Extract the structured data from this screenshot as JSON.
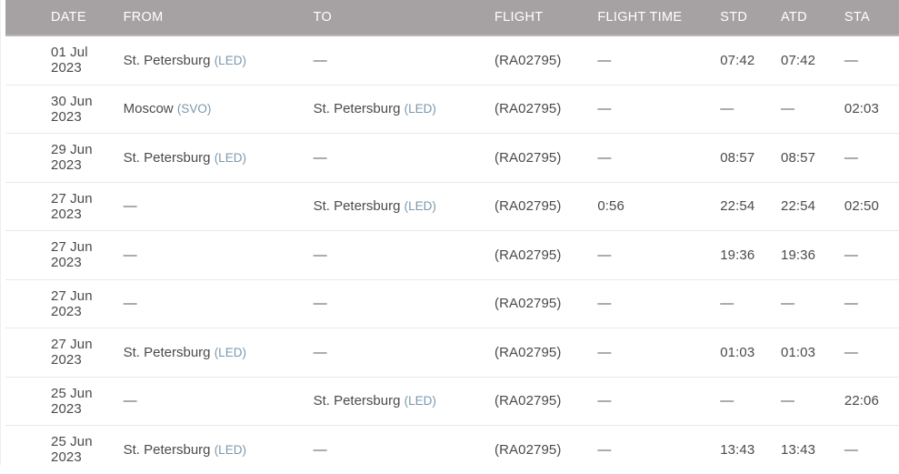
{
  "table": {
    "columns": [
      {
        "key": "date",
        "label": "DATE"
      },
      {
        "key": "from",
        "label": "FROM"
      },
      {
        "key": "to",
        "label": "TO"
      },
      {
        "key": "flight",
        "label": "FLIGHT"
      },
      {
        "key": "ftime",
        "label": "FLIGHT TIME"
      },
      {
        "key": "std",
        "label": "STD"
      },
      {
        "key": "atd",
        "label": "ATD"
      },
      {
        "key": "sta",
        "label": "STA"
      }
    ],
    "empty_value": "—",
    "rows": [
      {
        "date": "01 Jul 2023",
        "from_city": "St. Petersburg",
        "from_code": "(LED)",
        "to_city": "",
        "to_code": "",
        "to_empty": "—",
        "flight": "(RA02795)",
        "ftime": "—",
        "std": "07:42",
        "atd": "07:42",
        "sta": "—"
      },
      {
        "date": "30 Jun 2023",
        "from_city": "Moscow",
        "from_code": "(SVO)",
        "to_city": "St. Petersburg",
        "to_code": "(LED)",
        "to_empty": "",
        "flight": "(RA02795)",
        "ftime": "—",
        "std": "—",
        "atd": "—",
        "sta": "02:03"
      },
      {
        "date": "29 Jun 2023",
        "from_city": "St. Petersburg",
        "from_code": "(LED)",
        "to_city": "",
        "to_code": "",
        "to_empty": "—",
        "flight": "(RA02795)",
        "ftime": "—",
        "std": "08:57",
        "atd": "08:57",
        "sta": "—"
      },
      {
        "date": "27 Jun 2023",
        "from_city": "",
        "from_code": "",
        "from_empty": "—",
        "to_city": "St. Petersburg",
        "to_code": "(LED)",
        "to_empty": "",
        "flight": "(RA02795)",
        "ftime": "0:56",
        "std": "22:54",
        "atd": "22:54",
        "sta": "02:50"
      },
      {
        "date": "27 Jun 2023",
        "from_city": "",
        "from_code": "",
        "from_empty": "—",
        "to_city": "",
        "to_code": "",
        "to_empty": "—",
        "flight": "(RA02795)",
        "ftime": "—",
        "std": "19:36",
        "atd": "19:36",
        "sta": "—"
      },
      {
        "date": "27 Jun 2023",
        "from_city": "",
        "from_code": "",
        "from_empty": "—",
        "to_city": "",
        "to_code": "",
        "to_empty": "—",
        "flight": "(RA02795)",
        "ftime": "—",
        "std": "—",
        "atd": "—",
        "sta": "—"
      },
      {
        "date": "27 Jun 2023",
        "from_city": "St. Petersburg",
        "from_code": "(LED)",
        "to_city": "",
        "to_code": "",
        "to_empty": "—",
        "flight": "(RA02795)",
        "ftime": "—",
        "std": "01:03",
        "atd": "01:03",
        "sta": "—"
      },
      {
        "date": "25 Jun 2023",
        "from_city": "",
        "from_code": "",
        "from_empty": "—",
        "to_city": "St. Petersburg",
        "to_code": "(LED)",
        "to_empty": "",
        "flight": "(RA02795)",
        "ftime": "—",
        "std": "—",
        "atd": "—",
        "sta": "22:06"
      },
      {
        "date": "25 Jun 2023",
        "from_city": "St. Petersburg",
        "from_code": "(LED)",
        "to_city": "",
        "to_code": "",
        "to_empty": "—",
        "flight": "(RA02795)",
        "ftime": "—",
        "std": "13:43",
        "atd": "13:43",
        "sta": "—"
      }
    ]
  },
  "colors": {
    "header_bg": "#a6a2a3",
    "header_text": "#ffffff",
    "body_text": "#4a4a4a",
    "airport_code": "#7b98ad",
    "row_divider": "#e9e9ea",
    "page_bg": "#ffffff"
  }
}
